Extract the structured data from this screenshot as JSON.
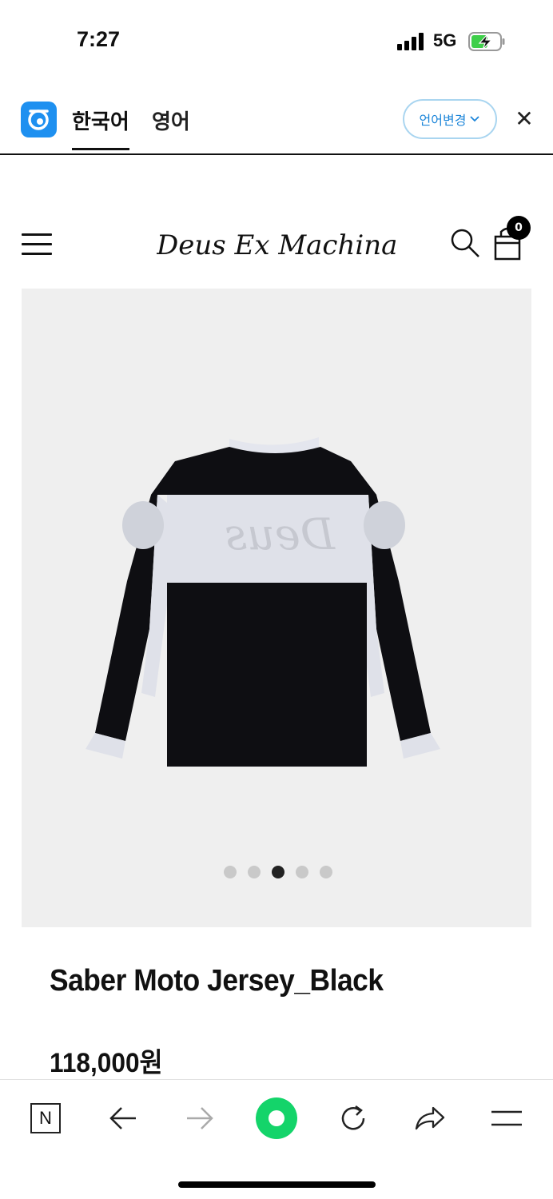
{
  "status_bar": {
    "time": "7:27",
    "network": "5G"
  },
  "translate_bar": {
    "source_lang": "한국어",
    "target_lang": "영어",
    "change_language_label": "언어변경",
    "close_symbol": "✕"
  },
  "header": {
    "brand": "Deus Ex Machina®",
    "cart_count": "0"
  },
  "gallery": {
    "slide_count": 5,
    "active_slide": 3
  },
  "product": {
    "title": "Saber Moto Jersey_Black",
    "price": "118,000원"
  },
  "toolbar": {
    "n_label": "N"
  },
  "colors": {
    "translate_accent": "#1d86d9",
    "papago_logo": "#1e90f0",
    "green_button": "#14d46a",
    "gallery_bg": "#efefef"
  },
  "icons": [
    "papago-icon",
    "chevron-down-icon",
    "close-icon",
    "menu-icon",
    "search-icon",
    "cart-icon",
    "back-arrow-icon",
    "forward-arrow-icon",
    "reload-icon",
    "share-icon",
    "hamburger-icon"
  ]
}
